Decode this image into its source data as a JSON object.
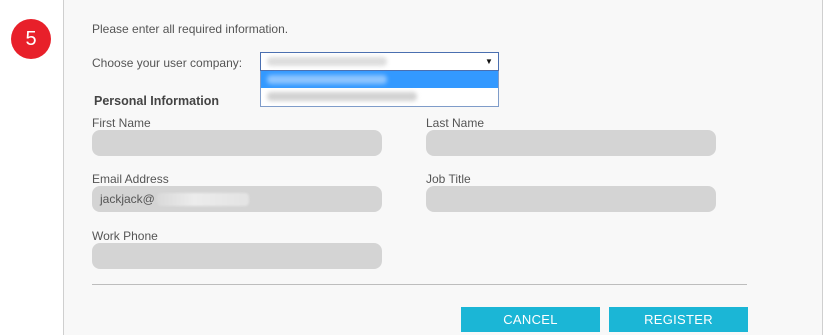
{
  "step": {
    "number": "5"
  },
  "form": {
    "instructions": "Please enter all required information.",
    "company_label": "Choose your user company:",
    "company_dropdown_arrow": "▼",
    "section_title": "Personal Information",
    "fields": {
      "first_name": {
        "label": "First Name",
        "value": ""
      },
      "last_name": {
        "label": "Last Name",
        "value": ""
      },
      "email": {
        "label": "Email Address",
        "value": "jackjack@"
      },
      "job_title": {
        "label": "Job Title",
        "value": ""
      },
      "work_phone": {
        "label": "Work Phone",
        "value": ""
      }
    }
  },
  "actions": {
    "cancel": "CANCEL",
    "register": "REGISTER"
  },
  "colors": {
    "badge": "#e8202a",
    "button": "#1bb6d6",
    "field_bg": "#d4d4d4",
    "dropdown_highlight": "#3399ff"
  }
}
